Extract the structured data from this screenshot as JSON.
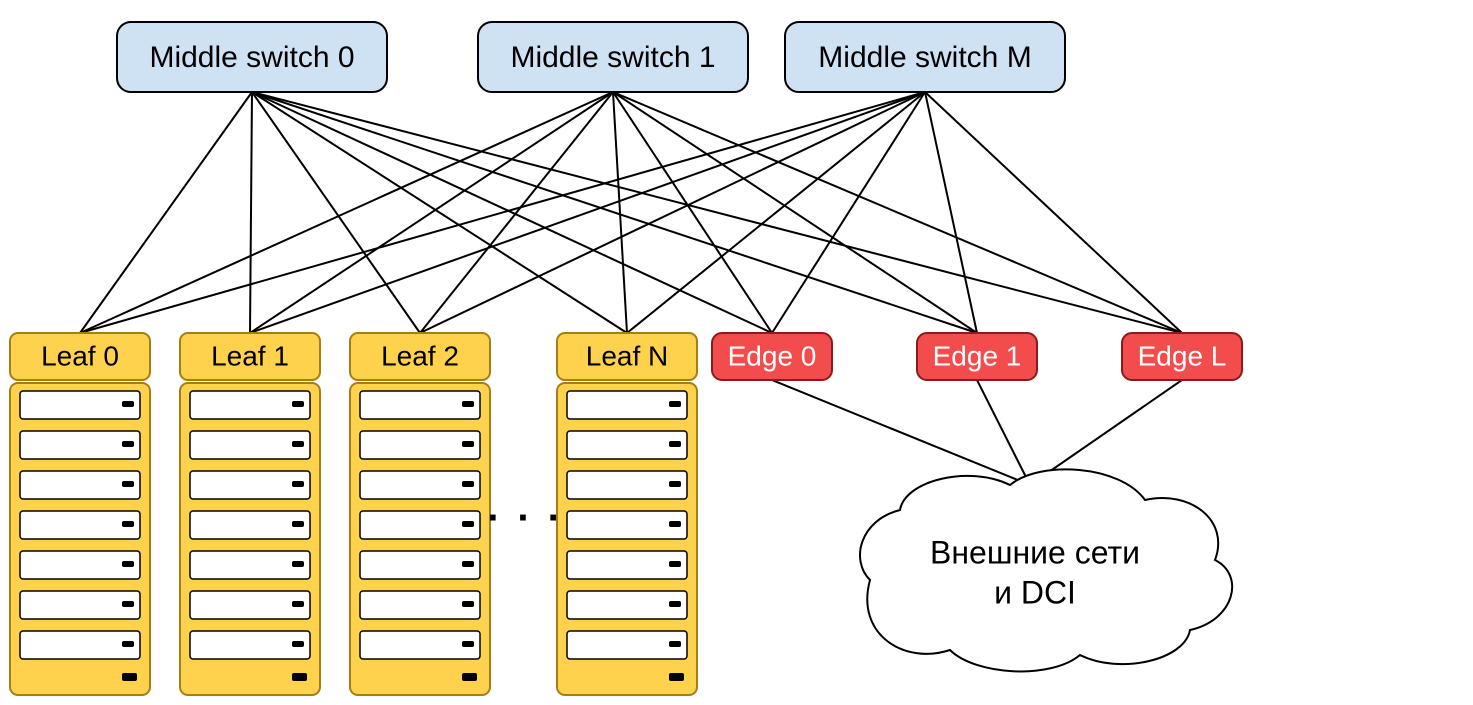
{
  "colors": {
    "switch_fill": "#cfe2f3",
    "leaf_fill": "#ffd24d",
    "leaf_stroke": "#a57f16",
    "edge_fill": "#f24c4c",
    "edge_stroke": "#8b1a1a",
    "line": "#000000"
  },
  "switches": [
    {
      "id": "switch0",
      "label": "Middle switch 0"
    },
    {
      "id": "switch1",
      "label": "Middle switch 1"
    },
    {
      "id": "switchM",
      "label": "Middle switch M"
    }
  ],
  "leaves": [
    {
      "id": "leaf0",
      "label": "Leaf 0"
    },
    {
      "id": "leaf1",
      "label": "Leaf 1"
    },
    {
      "id": "leaf2",
      "label": "Leaf 2"
    },
    {
      "id": "leafN",
      "label": "Leaf N"
    }
  ],
  "leaf_ellipsis": ". . .",
  "edges": [
    {
      "id": "edge0",
      "label": "Edge 0"
    },
    {
      "id": "edge1",
      "label": "Edge 1"
    },
    {
      "id": "edgeL",
      "label": "Edge L"
    }
  ],
  "cloud": {
    "line1": "Внешние сети",
    "line2": "и DCI"
  },
  "server_slots_per_rack": 7
}
